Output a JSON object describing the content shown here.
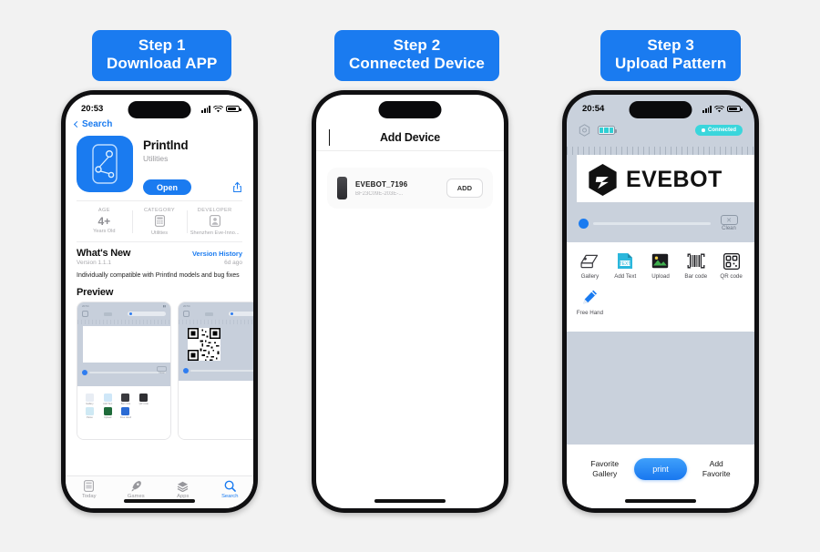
{
  "page": {
    "background": "#f2f2f2",
    "accent": "#1a7bf0",
    "teal": "#3ad6dc"
  },
  "steps": [
    {
      "line1": "Step 1",
      "line2": "Download APP"
    },
    {
      "line1": "Step 2",
      "line2": "Connected Device"
    },
    {
      "line1": "Step 3",
      "line2": "Upload Pattern"
    }
  ],
  "phone1": {
    "status": {
      "time": "20:53"
    },
    "back_label": "Search",
    "app": {
      "name": "Printlnd",
      "category": "Utilities",
      "open_label": "Open"
    },
    "info": [
      {
        "key": "AGE",
        "value": "4+",
        "caption": "Years Old"
      },
      {
        "key": "CATEGORY",
        "value": "",
        "caption": "Utilities"
      },
      {
        "key": "DEVELOPER",
        "value": "",
        "caption": "Shenzhen Eve-Inno..."
      }
    ],
    "whats_new": {
      "title": "What's New",
      "link": "Version History",
      "version": "Version 1.1.1",
      "ago": "6d ago",
      "body": "Individually compatible with Printlnd models and bug fixes"
    },
    "preview_title": "Preview",
    "preview_tools": [
      "Preview Gallery",
      "Add Text",
      "Bar code",
      "QR code",
      "Parse",
      "Upload",
      "Free Hand"
    ],
    "tabs": [
      {
        "label": "Today",
        "icon": "today-icon",
        "active": false
      },
      {
        "label": "Games",
        "icon": "rocket-icon",
        "active": false
      },
      {
        "label": "Apps",
        "icon": "stack-icon",
        "active": false
      },
      {
        "label": "Search",
        "icon": "search-icon",
        "active": true
      }
    ]
  },
  "phone2": {
    "nav_title": "Add Device",
    "device": {
      "name": "EVEBOT_7196",
      "id": "BF23C09E-203E-...",
      "add_label": "ADD"
    }
  },
  "phone3": {
    "status": {
      "time": "20:54"
    },
    "connected_label": "Connected",
    "brand": "EVEBOT",
    "clean_label": "Clean",
    "tools": [
      {
        "label": "Gallery",
        "icon": "gallery-icon"
      },
      {
        "label": "Add Text",
        "icon": "add-text-icon"
      },
      {
        "label": "Upload",
        "icon": "upload-image-icon"
      },
      {
        "label": "Bar code",
        "icon": "barcode-icon"
      },
      {
        "label": "QR code",
        "icon": "qrcode-icon"
      },
      {
        "label": "Free Hand",
        "icon": "pencil-icon"
      }
    ],
    "footer": {
      "left": "Favorite\nGallery",
      "left_l1": "Favorite",
      "left_l2": "Gallery",
      "print_label": "print",
      "right_l1": "Add",
      "right_l2": "Favorite"
    }
  }
}
